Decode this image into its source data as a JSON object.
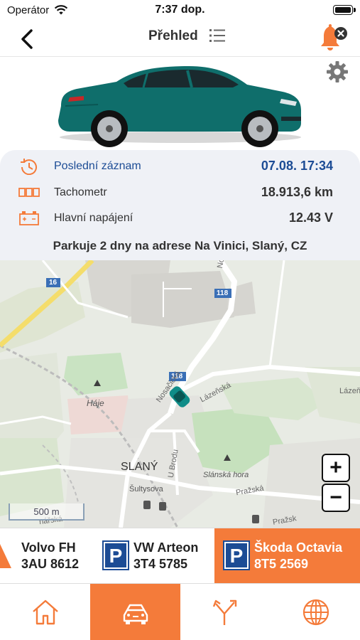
{
  "status_bar": {
    "carrier": "Operátor",
    "time": "7:37 dop."
  },
  "nav": {
    "title": "Přehled"
  },
  "info": {
    "last_record_label": "Poslední záznam",
    "last_record_value": "07.08. 17:34",
    "odometer_label": "Tachometr",
    "odometer_value": "18.913,6 km",
    "power_label": "Hlavní napájení",
    "power_value": "12.43 V",
    "parking_text": "Parkuje 2 dny na adrese Na Vinici, Slaný, CZ"
  },
  "map": {
    "labels": {
      "road_16": "16",
      "road_118_top": "118",
      "road_118_mid": "118",
      "street_nosacka_top": "Nosač",
      "street_nosacka": "Nosačická",
      "street_lazenska": "Lázeňská",
      "street_lazenska_right": "Lázeň",
      "place_haje": "Háje",
      "town_slany": "SLANÝ",
      "street_sultysova": "Šultysova",
      "street_ubrodu": "U Brodu",
      "place_slanska_hora": "Slánská hora",
      "street_prazska": "Pražská",
      "street_prazska2": "Pražsk",
      "street_fragment": "nářská"
    },
    "scale_label": "500 m",
    "zoom_in_label": "+",
    "zoom_out_label": "−"
  },
  "vehicles": [
    {
      "name": "Volvo FH",
      "plate": "3AU 8612",
      "icon": "truck-arrow-icon",
      "active": false
    },
    {
      "name": "VW Arteon",
      "plate": "3T4 5785",
      "icon": "parking-icon",
      "parking_letter": "P",
      "active": false
    },
    {
      "name": "Škoda Octavia",
      "plate": "8T5 2569",
      "icon": "parking-icon",
      "parking_letter": "P",
      "active": true
    }
  ],
  "tabs": [
    {
      "icon": "home-icon",
      "active": false
    },
    {
      "icon": "car-icon",
      "active": true
    },
    {
      "icon": "route-icon",
      "active": false
    },
    {
      "icon": "globe-icon",
      "active": false
    }
  ],
  "colors": {
    "accent": "#f47b3a",
    "link": "#1c4c95",
    "car_body": "#0f6e6b",
    "info_bg": "#eff1f6"
  }
}
